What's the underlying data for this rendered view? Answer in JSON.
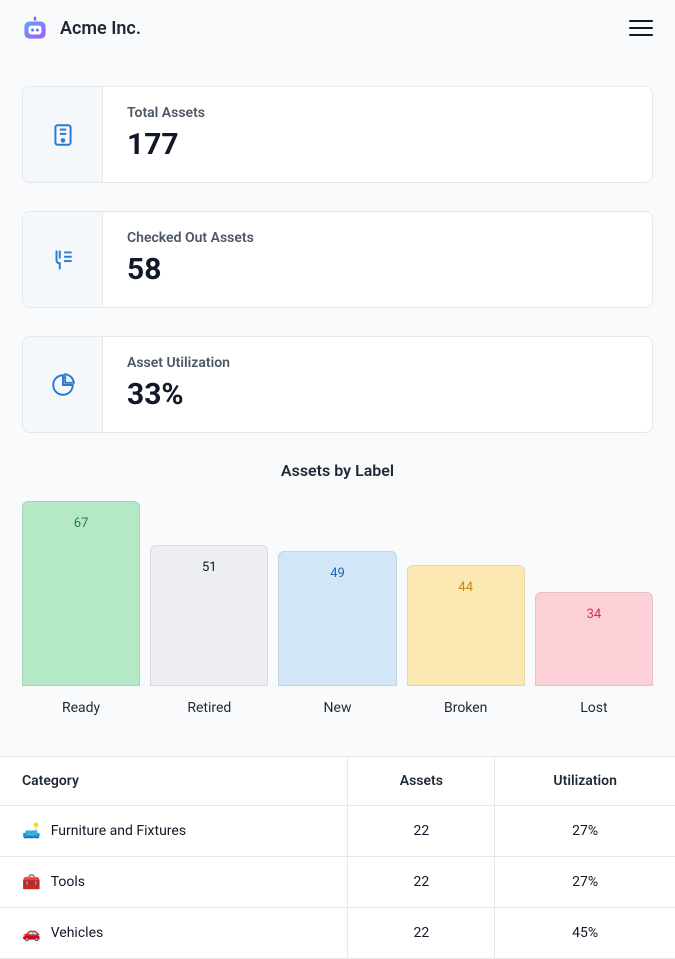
{
  "brand": {
    "name": "Acme Inc."
  },
  "stats": [
    {
      "label": "Total Assets",
      "value": "177"
    },
    {
      "label": "Checked Out Assets",
      "value": "58"
    },
    {
      "label": "Asset Utilization",
      "value": "33%"
    }
  ],
  "chart_data": {
    "type": "bar",
    "title": "Assets by Label",
    "categories": [
      "Ready",
      "Retired",
      "New",
      "Broken",
      "Lost"
    ],
    "values": [
      67,
      51,
      49,
      44,
      34
    ],
    "colors": [
      "#b5e9c6",
      "#eceef1",
      "#d2e6f7",
      "#fce8b2",
      "#fbd0d6"
    ],
    "text_colors": [
      "#22803f",
      "#111827",
      "#2563c0",
      "#c08a1b",
      "#dc2b4a"
    ]
  },
  "table": {
    "headers": [
      "Category",
      "Assets",
      "Utilization"
    ],
    "rows": [
      {
        "emoji": "🛋️",
        "name": "Furniture and Fixtures",
        "assets": "22",
        "util": "27%"
      },
      {
        "emoji": "🧰",
        "name": "Tools",
        "assets": "22",
        "util": "27%"
      },
      {
        "emoji": "🚗",
        "name": "Vehicles",
        "assets": "22",
        "util": "45%"
      }
    ]
  }
}
